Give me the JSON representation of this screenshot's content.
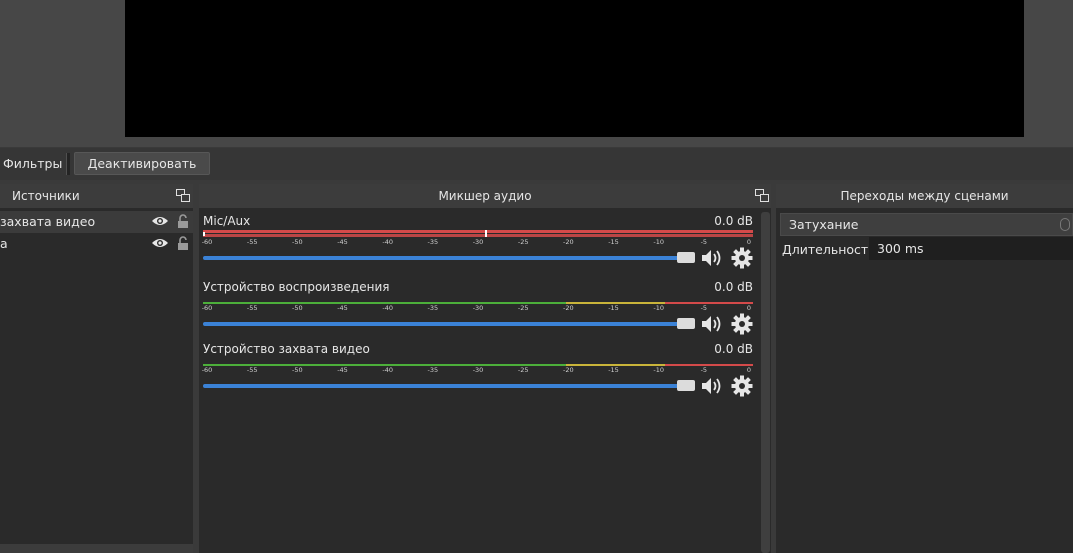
{
  "toolbar": {
    "filters_label": "Фильтры",
    "deactivate_label": "Деактивировать"
  },
  "sources": {
    "title": "Источники",
    "items": [
      {
        "label": "захвата видео",
        "visible": true,
        "locked": false,
        "selected": true
      },
      {
        "label": "a",
        "visible": true,
        "locked": false,
        "selected": false
      }
    ]
  },
  "mixer": {
    "title": "Микшер аудио",
    "scale_ticks": [
      "-60",
      "-55",
      "-50",
      "-45",
      "-40",
      "-35",
      "-30",
      "-25",
      "-20",
      "-15",
      "-10",
      "-5",
      "0"
    ],
    "channels": [
      {
        "name": "Mic/Aux",
        "db": "0.0 dB",
        "muted_meter": true,
        "volume": 1.0
      },
      {
        "name": "Устройство воспроизведения",
        "db": "0.0 dB",
        "muted_meter": false,
        "volume": 1.0
      },
      {
        "name": "Устройство захвата видео",
        "db": "0.0 dB",
        "muted_meter": false,
        "volume": 1.0
      }
    ],
    "colors": {
      "green": "#4caf3a",
      "yellow": "#c9b43a",
      "red": "#d44a4a",
      "fader": "#3b82d6"
    }
  },
  "transitions": {
    "title": "Переходы между сценами",
    "selected": "Затухание",
    "duration_label": "Длительность",
    "duration_value": "300 ms"
  }
}
